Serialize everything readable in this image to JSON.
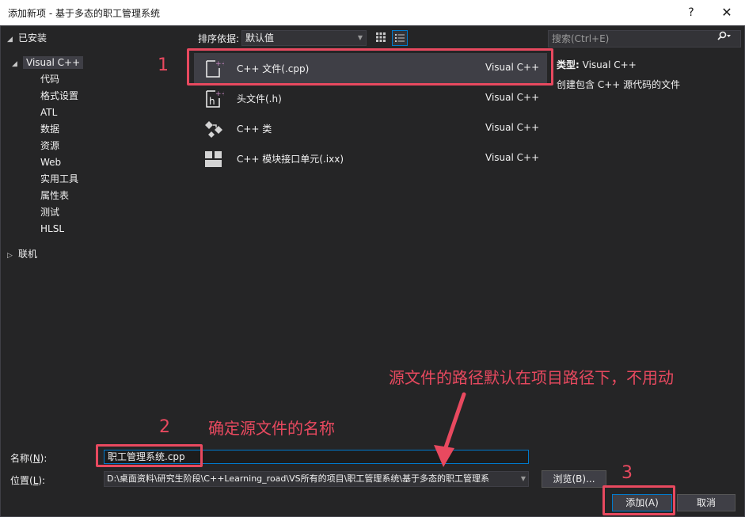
{
  "window": {
    "title": "添加新项 - 基于多态的职工管理系统",
    "help": "?",
    "close": "✕"
  },
  "tree": {
    "installed": "已安装",
    "visual_cpp": "Visual C++",
    "children": [
      "代码",
      "格式设置",
      "ATL",
      "数据",
      "资源",
      "Web",
      "实用工具",
      "属性表",
      "测试",
      "HLSL"
    ],
    "online": "联机"
  },
  "toolbar": {
    "sort_label": "排序依据:",
    "sort_value": "默认值"
  },
  "templates": [
    {
      "name": "C++ 文件(.cpp)",
      "lang": "Visual C++",
      "icon": "cpp-file-icon"
    },
    {
      "name": "头文件(.h)",
      "lang": "Visual C++",
      "icon": "header-file-icon"
    },
    {
      "name": "C++ 类",
      "lang": "Visual C++",
      "icon": "cpp-class-icon"
    },
    {
      "name": "C++ 模块接口单元(.ixx)",
      "lang": "Visual C++",
      "icon": "module-interface-icon"
    }
  ],
  "details": {
    "search_placeholder": "搜索(Ctrl+E)",
    "type_label": "类型:",
    "type_value": "Visual C++",
    "description": "创建包含 C++ 源代码的文件"
  },
  "form": {
    "name_label_a": "名称(",
    "name_label_key": "N",
    "name_label_b": "):",
    "name_value": "职工管理系统.cpp",
    "location_label_a": "位置(",
    "location_label_key": "L",
    "location_label_b": "):",
    "location_value": "D:\\桌面资料\\研究生阶段\\C++Learning_road\\VS所有的项目\\职工管理系统\\基于多态的职工管理系",
    "browse_label": "浏览(B)...",
    "add_label": "添加(A)",
    "cancel_label": "取消"
  },
  "annotations": {
    "num1": "1",
    "num2": "2",
    "num3": "3",
    "note_name": "确定源文件的名称",
    "note_path": "源文件的路径默认在项目路径下，不用动"
  },
  "colors": {
    "accent": "#007acc",
    "annotation": "#e8495f",
    "background": "#252526"
  }
}
